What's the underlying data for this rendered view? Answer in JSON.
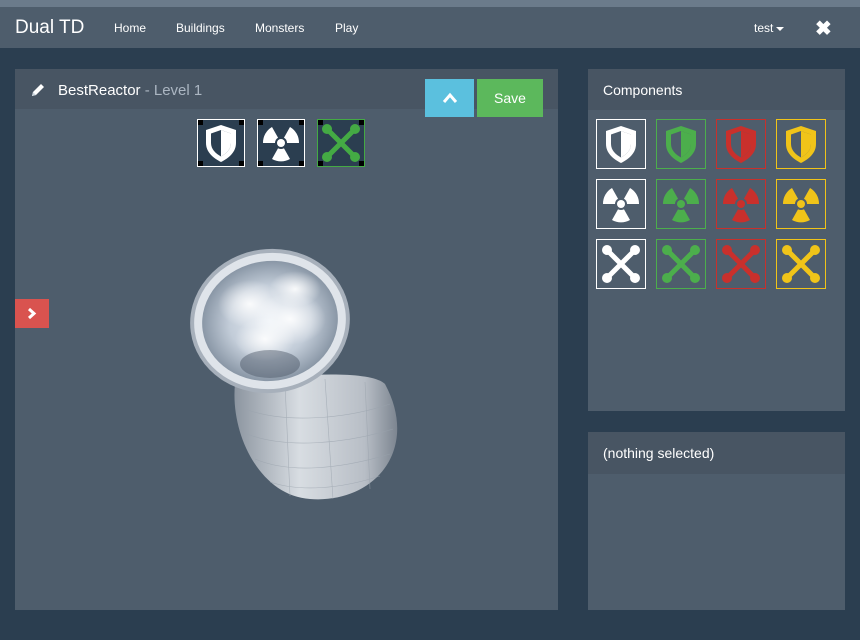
{
  "navbar": {
    "brand": "Dual TD",
    "links": [
      "Home",
      "Buildings",
      "Monsters",
      "Play"
    ],
    "user": "test",
    "close_icon": "close-icon"
  },
  "editor": {
    "building_name": "BestReactor",
    "level_text": " - Level 1",
    "save_label": "Save",
    "up_icon": "chevron-up-icon",
    "expand_icon": "chevron-right-icon",
    "slots": [
      "shield-icon",
      "radiation-icon",
      "tools-icon"
    ],
    "slot_colors": [
      "#ffffff",
      "#ffffff",
      "#44aa44"
    ]
  },
  "components": {
    "title": "Components",
    "rows": [
      {
        "type": "shield-icon",
        "colors": [
          "#ffffff",
          "#4cae4c",
          "#c9302c",
          "#f0c419"
        ]
      },
      {
        "type": "radiation-icon",
        "colors": [
          "#ffffff",
          "#4cae4c",
          "#c9302c",
          "#f0c419"
        ]
      },
      {
        "type": "tools-icon",
        "colors": [
          "#ffffff",
          "#4cae4c",
          "#c9302c",
          "#f0c419"
        ]
      }
    ]
  },
  "selection": {
    "title": "(nothing selected)"
  }
}
